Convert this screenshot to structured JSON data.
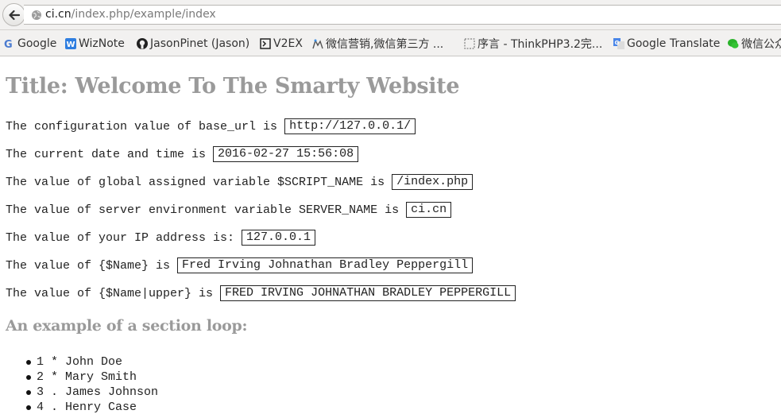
{
  "browser": {
    "url_host": "ci.cn",
    "url_path": "/index.php/example/index",
    "bookmarks": [
      {
        "label": "Google",
        "icon": "google-icon"
      },
      {
        "label": "WizNote",
        "icon": "wiznote-icon"
      },
      {
        "label": "JasonPinet (Jason)",
        "icon": "github-icon"
      },
      {
        "label": "V2EX",
        "icon": "v2ex-icon"
      },
      {
        "label": "微信营销,微信第三方 ...",
        "icon": "weixin-marketing-icon"
      },
      {
        "label": "序言 - ThinkPHP3.2完...",
        "icon": "page-icon"
      },
      {
        "label": "Google Translate",
        "icon": "translate-icon"
      },
      {
        "label": "微信公众",
        "icon": "wechat-icon"
      }
    ]
  },
  "page": {
    "title": "Title: Welcome To The Smarty Website",
    "lines": [
      {
        "label": "The configuration value of base_url is",
        "value": "http://127.0.0.1/"
      },
      {
        "label": "The current date and time is",
        "value": "2016-02-27 15:56:08"
      },
      {
        "label": "The value of global assigned variable $SCRIPT_NAME is",
        "value": "/index.php"
      },
      {
        "label": "The value of server environment variable SERVER_NAME is",
        "value": "ci.cn"
      },
      {
        "label": "The value of your IP address is:",
        "value": "127.0.0.1"
      },
      {
        "label": "The value of {$Name} is",
        "value": "Fred Irving Johnathan Bradley Peppergill"
      },
      {
        "label": "The value of {$Name|upper} is",
        "value": "FRED IRVING JOHNATHAN BRADLEY PEPPERGILL"
      }
    ],
    "section_heading": "An example of a section loop:",
    "loop_items": [
      "1 * John Doe",
      "2 * Mary Smith",
      "3 . James Johnson",
      "4 . Henry Case"
    ]
  },
  "colors": {
    "heading_gray": "#9a9a9a",
    "chrome_bg": "#f2f1f0"
  }
}
